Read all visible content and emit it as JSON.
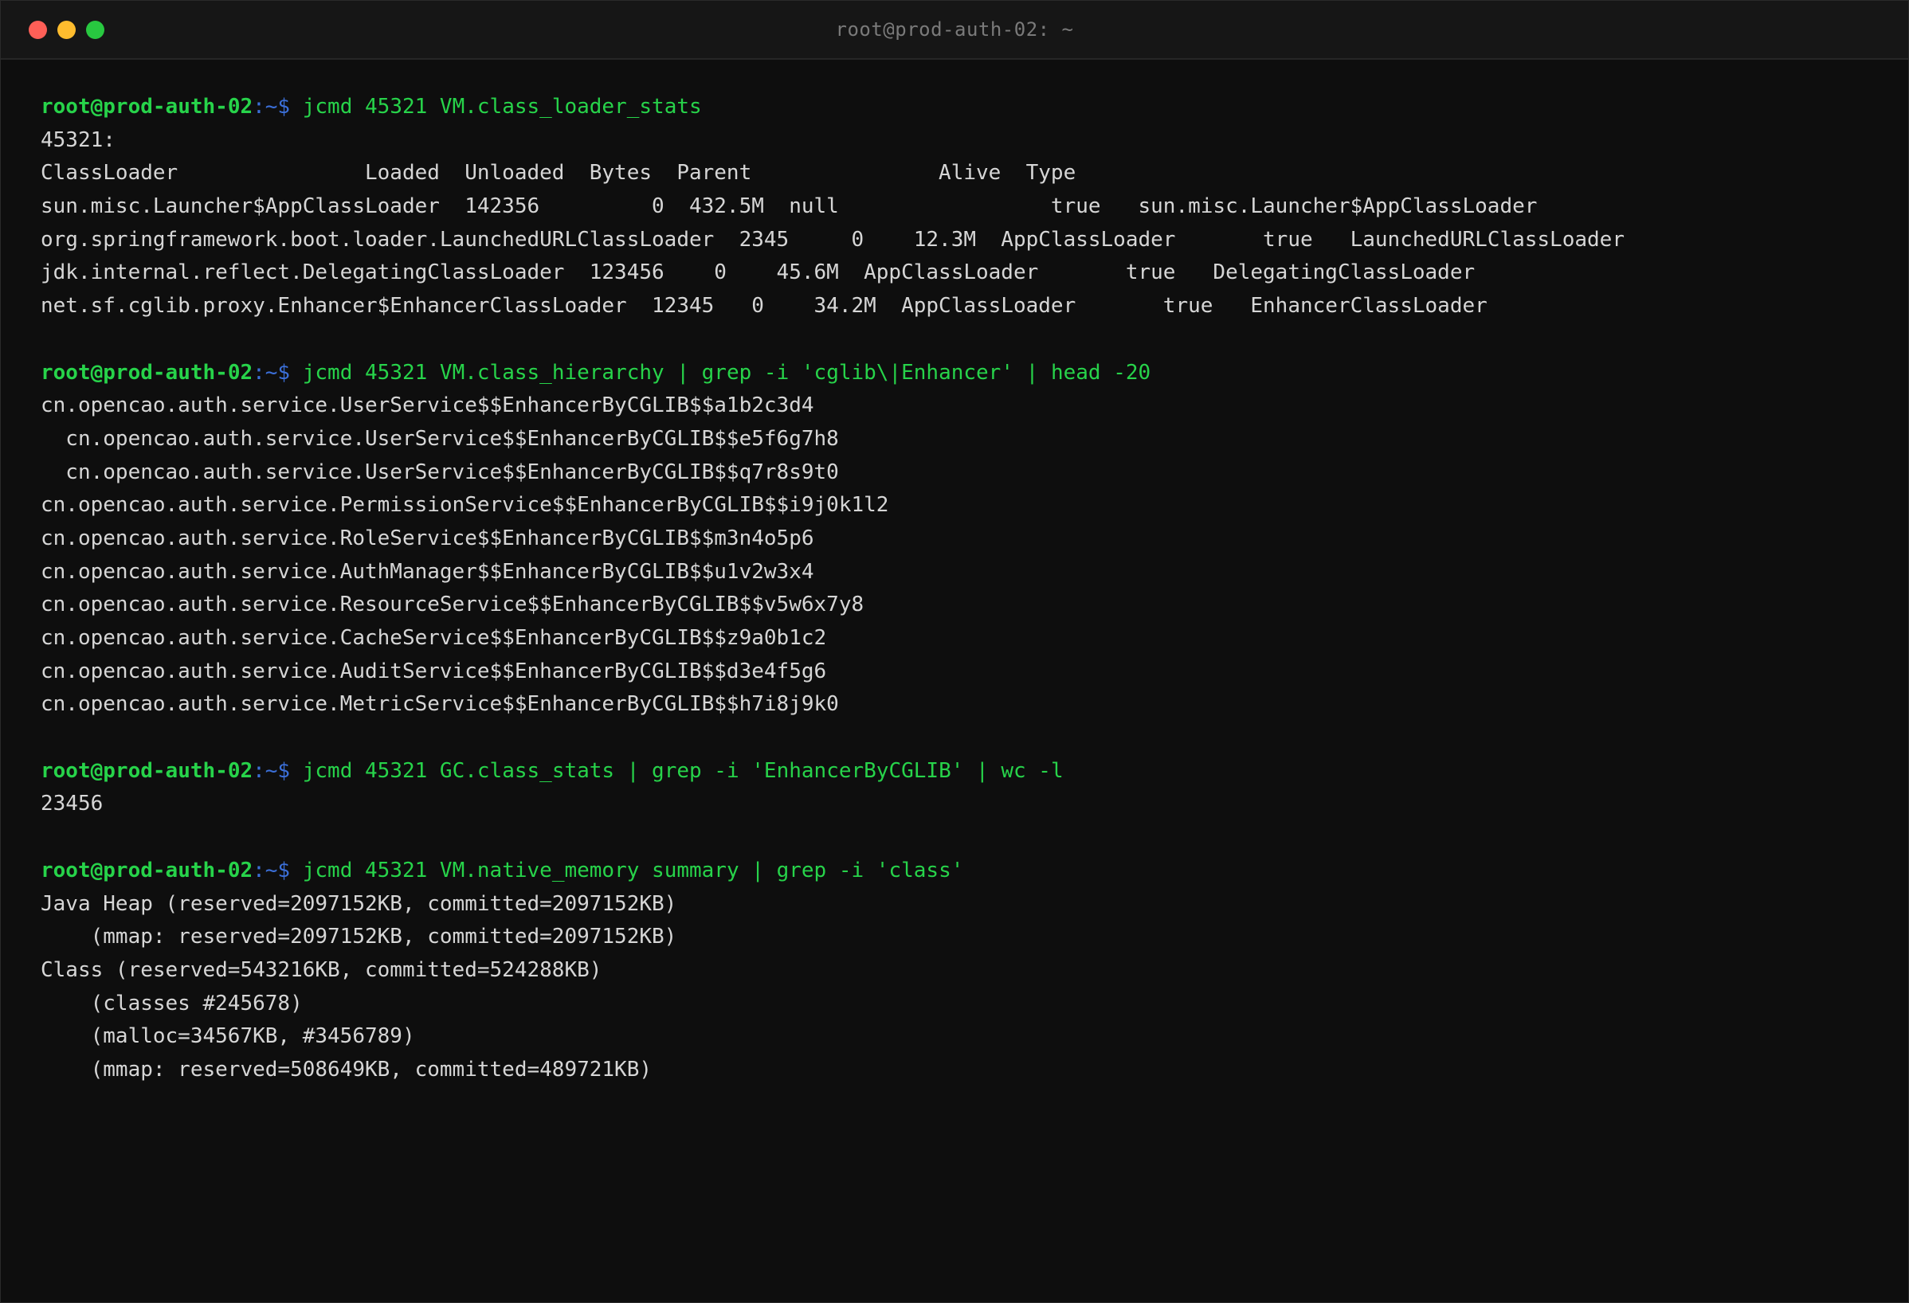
{
  "window": {
    "title": "root@prod-auth-02: ~"
  },
  "prompt": {
    "user": "root",
    "at": "@",
    "host": "prod-auth-02",
    "path": ":~$ "
  },
  "blocks": [
    {
      "command": "jcmd 45321 VM.class_loader_stats",
      "output": [
        "45321:",
        "ClassLoader               Loaded  Unloaded  Bytes  Parent               Alive  Type",
        "sun.misc.Launcher$AppClassLoader  142356         0  432.5M  null                 true   sun.misc.Launcher$AppClassLoader",
        "org.springframework.boot.loader.LaunchedURLClassLoader  2345     0    12.3M  AppClassLoader       true   LaunchedURLClassLoader",
        "jdk.internal.reflect.DelegatingClassLoader  123456    0    45.6M  AppClassLoader       true   DelegatingClassLoader",
        "net.sf.cglib.proxy.Enhancer$EnhancerClassLoader  12345   0    34.2M  AppClassLoader       true   EnhancerClassLoader"
      ]
    },
    {
      "command": "jcmd 45321 VM.class_hierarchy | grep -i 'cglib\\|Enhancer' | head -20",
      "output": [
        "cn.opencao.auth.service.UserService$$EnhancerByCGLIB$$a1b2c3d4",
        "  cn.opencao.auth.service.UserService$$EnhancerByCGLIB$$e5f6g7h8",
        "  cn.opencao.auth.service.UserService$$EnhancerByCGLIB$$q7r8s9t0",
        "cn.opencao.auth.service.PermissionService$$EnhancerByCGLIB$$i9j0k1l2",
        "cn.opencao.auth.service.RoleService$$EnhancerByCGLIB$$m3n4o5p6",
        "cn.opencao.auth.service.AuthManager$$EnhancerByCGLIB$$u1v2w3x4",
        "cn.opencao.auth.service.ResourceService$$EnhancerByCGLIB$$v5w6x7y8",
        "cn.opencao.auth.service.CacheService$$EnhancerByCGLIB$$z9a0b1c2",
        "cn.opencao.auth.service.AuditService$$EnhancerByCGLIB$$d3e4f5g6",
        "cn.opencao.auth.service.MetricService$$EnhancerByCGLIB$$h7i8j9k0"
      ]
    },
    {
      "command": "jcmd 45321 GC.class_stats | grep -i 'EnhancerByCGLIB' | wc -l",
      "output": [
        "23456"
      ]
    },
    {
      "command": "jcmd 45321 VM.native_memory summary | grep -i 'class'",
      "output": [
        "Java Heap (reserved=2097152KB, committed=2097152KB)",
        "    (mmap: reserved=2097152KB, committed=2097152KB)",
        "Class (reserved=543216KB, committed=524288KB)",
        "    (classes #245678)",
        "    (malloc=34567KB, #3456789)",
        "    (mmap: reserved=508649KB, committed=489721KB)"
      ]
    }
  ]
}
